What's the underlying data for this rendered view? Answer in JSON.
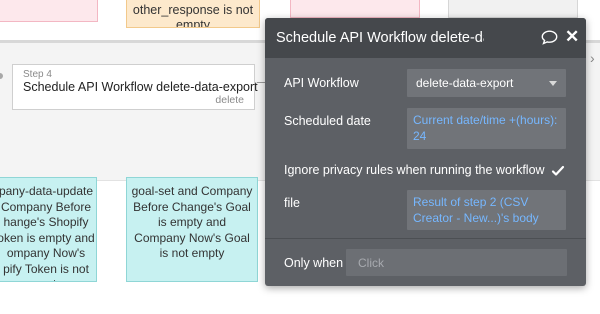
{
  "canvas": {
    "orange_card_text": "other_response is not empty",
    "step": {
      "number": "Step 4",
      "title": "Schedule API Workflow delete-data-export",
      "action": "delete"
    },
    "condition_left_lines": [
      "pany-data-update",
      "Company Before",
      "hange's Shopify",
      "oken is empty and",
      "ompany Now's",
      "pify Token is not",
      "empty"
    ],
    "condition_mid_lines": [
      "goal-set and Company",
      "Before Change's Goal",
      "is empty and",
      "Company Now's Goal",
      "is not empty"
    ]
  },
  "panel": {
    "title": "Schedule API Workflow delete-data-export",
    "fields": {
      "api_workflow_label": "API Workflow",
      "api_workflow_value": "delete-data-export",
      "scheduled_date_label": "Scheduled date",
      "scheduled_date_value": "Current date/time +(hours): 24",
      "ignore_privacy_label": "Ignore privacy rules when running the workflow",
      "ignore_privacy_checked": true,
      "file_label": "file",
      "file_value": "Result of step 2 (CSV Creator - New...)'s body",
      "only_when_label": "Only when",
      "only_when_placeholder": "Click"
    }
  },
  "icons": {
    "comment": "comment-icon",
    "close": "close-icon",
    "checkmark": "checkmark-icon",
    "dropdown": "chevron-down-icon",
    "edge_arrow": "chevron-right-icon"
  },
  "colors": {
    "panel_bg": "#5d6065",
    "panel_header": "#45484c",
    "dynamic_text": "#76b7ff",
    "condition_card": "#c7f1f1",
    "orange_card": "#fde9cc"
  }
}
